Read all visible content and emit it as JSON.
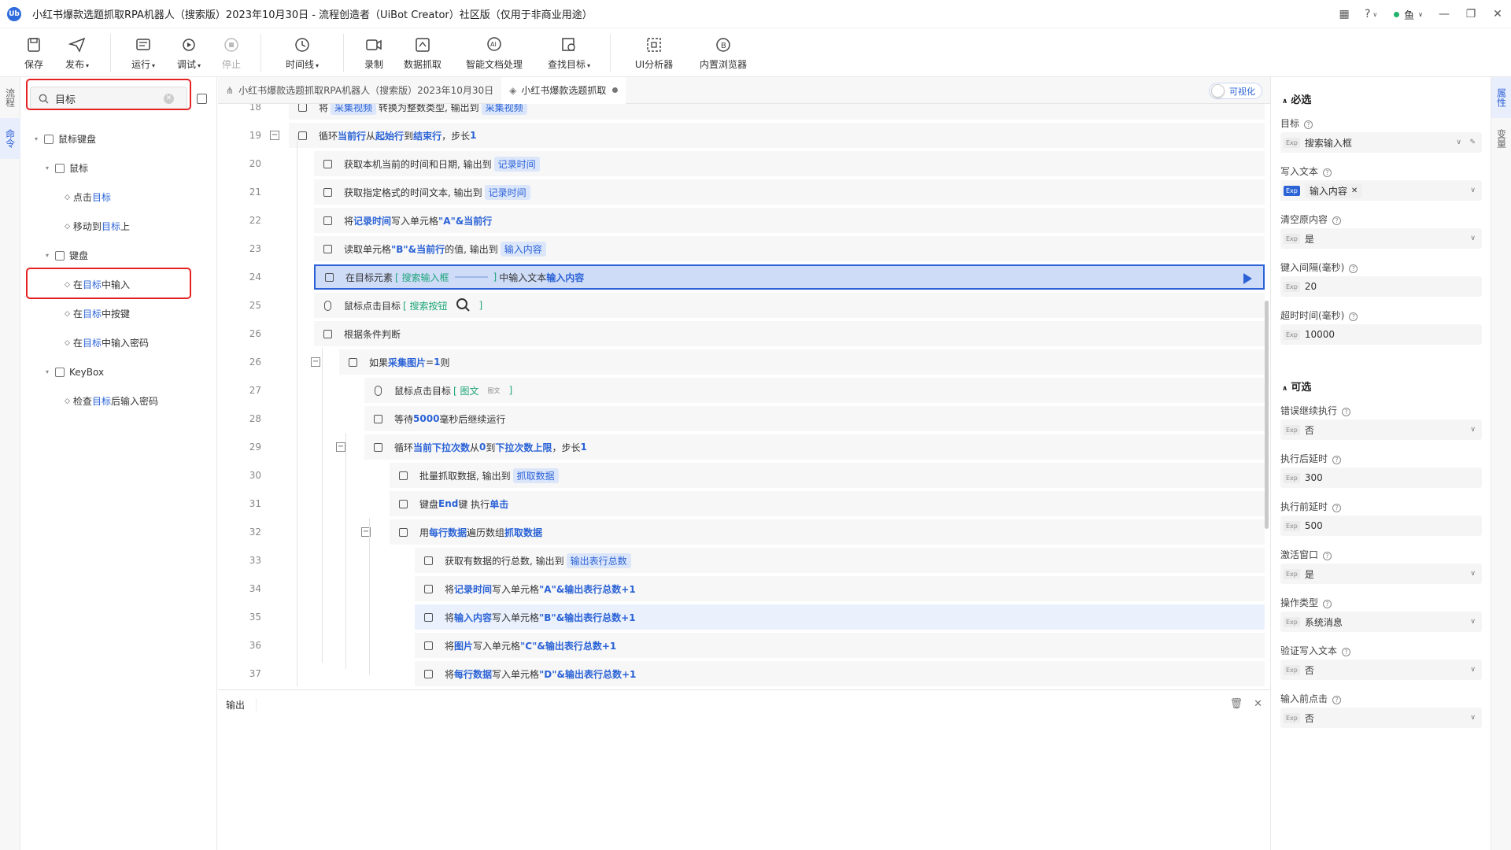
{
  "app": {
    "logo_text": "Ub",
    "title": "小红书爆款选题抓取RPA机器人（搜索版）2023年10月30日 - 流程创造者（UiBot Creator）社区版（仅用于非商业用途）",
    "user": "鱼"
  },
  "toolbar": [
    {
      "label": "保存",
      "icon": "save-icon",
      "caret": false
    },
    {
      "label": "发布",
      "icon": "send-icon",
      "caret": true
    },
    {
      "label": "运行",
      "icon": "run-icon",
      "caret": true
    },
    {
      "label": "调试",
      "icon": "debug-icon",
      "caret": true
    },
    {
      "label": "停止",
      "icon": "stop-icon",
      "caret": false
    },
    {
      "label": "时间线",
      "icon": "clock-icon",
      "caret": true
    },
    {
      "label": "录制",
      "icon": "record-icon",
      "caret": false
    },
    {
      "label": "数据抓取",
      "icon": "scrape-icon",
      "caret": false
    },
    {
      "label": "智能文档处理",
      "icon": "ai-doc-icon",
      "caret": false
    },
    {
      "label": "查找目标",
      "icon": "find-target-icon",
      "caret": true
    },
    {
      "label": "UI分析器",
      "icon": "ui-analyzer-icon",
      "caret": false
    },
    {
      "label": "内置浏览器",
      "icon": "browser-icon",
      "caret": false
    }
  ],
  "rail": {
    "tab1": "流程",
    "tab2": "命令"
  },
  "right_rail": {
    "tab1": "属性",
    "tab2": "变量"
  },
  "search": {
    "value": "目标",
    "placeholder": ""
  },
  "tree": {
    "root": "鼠标键盘",
    "mouse": "鼠标",
    "mouse_items": [
      [
        "点击",
        "目标",
        ""
      ],
      [
        "移动到",
        "目标",
        "上"
      ]
    ],
    "keyboard": "键盘",
    "keyboard_items": [
      [
        "在",
        "目标",
        "中输入"
      ],
      [
        "在",
        "目标",
        "中按键"
      ],
      [
        "在",
        "目标",
        "中输入密码"
      ]
    ],
    "keybox": "KeyBox",
    "keybox_items": [
      [
        "检查",
        "目标",
        "后输入密码"
      ]
    ]
  },
  "tabs": {
    "tab1": "小红书爆款选题抓取RPA机器人（搜索版）2023年10月30日",
    "tab2": "小红书爆款选题抓取",
    "visual": "可视化"
  },
  "code_rows": [
    {
      "n": "18",
      "parts": [
        [
          "t",
          "将 "
        ],
        [
          "v",
          "采集视频"
        ],
        [
          "t",
          " 转换为整数类型, 输出到 "
        ],
        [
          "v",
          "采集视频"
        ]
      ]
    },
    {
      "n": "19",
      "parts": [
        [
          "t",
          "循环 "
        ],
        [
          "k",
          "当前行"
        ],
        [
          "t",
          " 从 "
        ],
        [
          "k",
          "起始行"
        ],
        [
          "t",
          " 到 "
        ],
        [
          "k",
          "结束行"
        ],
        [
          "t",
          " ，步长 "
        ],
        [
          "k",
          "1"
        ]
      ]
    },
    {
      "n": "20",
      "parts": [
        [
          "t",
          "获取本机当前的时间和日期, 输出到 "
        ],
        [
          "v",
          "记录时间"
        ]
      ]
    },
    {
      "n": "21",
      "parts": [
        [
          "t",
          "获取指定格式的时间文本, 输出到 "
        ],
        [
          "v",
          "记录时间"
        ]
      ]
    },
    {
      "n": "22",
      "parts": [
        [
          "t",
          "将 "
        ],
        [
          "k",
          "记录时间"
        ],
        [
          "t",
          " 写入单元格 "
        ],
        [
          "k",
          "\"A\"&当前行"
        ]
      ]
    },
    {
      "n": "23",
      "parts": [
        [
          "t",
          "读取单元格 "
        ],
        [
          "k",
          "\"B\"&当前行"
        ],
        [
          "t",
          " 的值, 输出到 "
        ],
        [
          "v",
          "输入内容"
        ]
      ]
    },
    {
      "n": "24",
      "parts": [
        [
          "t",
          "在目标元素 "
        ],
        [
          "g",
          "[ 搜索输入框"
        ],
        [
          "line",
          ""
        ],
        [
          "g",
          "]"
        ],
        [
          "t",
          " 中输入文本 "
        ],
        [
          "k",
          "输入内容"
        ]
      ]
    },
    {
      "n": "25",
      "parts": [
        [
          "t",
          "鼠标点击目标 "
        ],
        [
          "g",
          "[ 搜索按钮"
        ],
        [
          "mag",
          ""
        ],
        [
          "g",
          "]"
        ]
      ]
    },
    {
      "n": "26",
      "parts": [
        [
          "t",
          "根据条件判断"
        ]
      ]
    },
    {
      "n": "26",
      "parts": [
        [
          "t",
          "如果 "
        ],
        [
          "k",
          "采集图片"
        ],
        [
          "t",
          " = "
        ],
        [
          "k",
          "1"
        ],
        [
          "t",
          " 则"
        ]
      ]
    },
    {
      "n": "27",
      "parts": [
        [
          "t",
          "鼠标点击目标 "
        ],
        [
          "g",
          "[ 图文"
        ],
        [
          "small",
          "图文"
        ],
        [
          "g",
          "]"
        ]
      ]
    },
    {
      "n": "28",
      "parts": [
        [
          "t",
          "等待 "
        ],
        [
          "k",
          "5000"
        ],
        [
          "t",
          " 毫秒后继续运行"
        ]
      ]
    },
    {
      "n": "29",
      "parts": [
        [
          "t",
          "循环 "
        ],
        [
          "k",
          "当前下拉次数"
        ],
        [
          "t",
          " 从 "
        ],
        [
          "k",
          "0"
        ],
        [
          "t",
          " 到 "
        ],
        [
          "k",
          "下拉次数上限"
        ],
        [
          "t",
          " ，步长 "
        ],
        [
          "k",
          "1"
        ]
      ]
    },
    {
      "n": "30",
      "parts": [
        [
          "t",
          "批量抓取数据, 输出到 "
        ],
        [
          "v",
          "抓取数据"
        ]
      ]
    },
    {
      "n": "31",
      "parts": [
        [
          "t",
          "键盘 "
        ],
        [
          "k",
          "End"
        ],
        [
          "t",
          " 键 执行 "
        ],
        [
          "k",
          "单击"
        ]
      ]
    },
    {
      "n": "32",
      "parts": [
        [
          "t",
          "用 "
        ],
        [
          "k",
          "每行数据"
        ],
        [
          "t",
          " 遍历数组 "
        ],
        [
          "k",
          "抓取数据"
        ]
      ]
    },
    {
      "n": "33",
      "parts": [
        [
          "t",
          "获取有数据的行总数, 输出到 "
        ],
        [
          "v",
          "输出表行总数"
        ]
      ]
    },
    {
      "n": "34",
      "parts": [
        [
          "t",
          "将 "
        ],
        [
          "k",
          "记录时间"
        ],
        [
          "t",
          " 写入单元格 "
        ],
        [
          "k",
          "\"A\"&输出表行总数+1"
        ]
      ]
    },
    {
      "n": "35",
      "parts": [
        [
          "t",
          "将 "
        ],
        [
          "k",
          "输入内容"
        ],
        [
          "t",
          " 写入单元格 "
        ],
        [
          "k",
          "\"B\"&输出表行总数+1"
        ]
      ]
    },
    {
      "n": "36",
      "parts": [
        [
          "t",
          "将 "
        ],
        [
          "k",
          "图片"
        ],
        [
          "t",
          " 写入单元格 "
        ],
        [
          "k",
          "\"C\"&输出表行总数+1"
        ]
      ]
    },
    {
      "n": "37",
      "parts": [
        [
          "t",
          "将 "
        ],
        [
          "k",
          "每行数据"
        ],
        [
          "t",
          " 写入单元格 "
        ],
        [
          "k",
          "\"D\"&输出表行总数+1"
        ]
      ]
    }
  ],
  "output": {
    "tab": "输出"
  },
  "props": {
    "required_title": "必选",
    "optional_title": "可选",
    "exp": "Exp",
    "fields": [
      {
        "label": "目标",
        "value": "搜索输入框"
      },
      {
        "label": "写入文本",
        "value": "输入内容"
      },
      {
        "label": "清空原内容",
        "value": "是"
      },
      {
        "label": "键入间隔(毫秒)",
        "value": "20"
      },
      {
        "label": "超时时间(毫秒)",
        "value": "10000"
      }
    ],
    "optional_fields": [
      {
        "label": "错误继续执行",
        "value": "否"
      },
      {
        "label": "执行后延时",
        "value": "300"
      },
      {
        "label": "执行前延时",
        "value": "500"
      },
      {
        "label": "激活窗口",
        "value": "是"
      },
      {
        "label": "操作类型",
        "value": "系统消息"
      },
      {
        "label": "验证写入文本",
        "value": "否"
      },
      {
        "label": "输入前点击",
        "value": "否"
      }
    ]
  },
  "colors": {
    "accent": "#2b63d6",
    "highlight_red": "#e52222",
    "target_green": "#1ea57a"
  }
}
